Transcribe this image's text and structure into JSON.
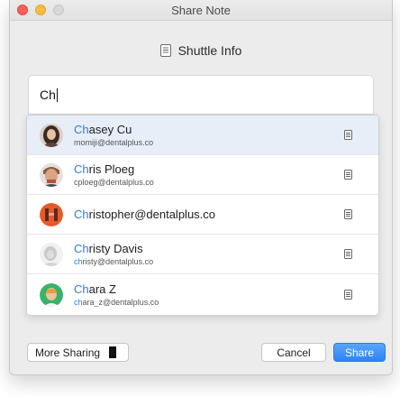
{
  "window": {
    "title": "Share Note"
  },
  "note": {
    "title": "Shuttle Info",
    "icon": "note-document-icon"
  },
  "search": {
    "prefix": "Ch",
    "value": ""
  },
  "contacts": [
    {
      "highlight": "Ch",
      "name_rest": "asey Cu",
      "email_highlight": "",
      "email_rest": "momiji@dentalplus.co",
      "selected": true,
      "avatar": "woman-photo"
    },
    {
      "highlight": "Ch",
      "name_rest": "ris Ploeg",
      "email_highlight": "",
      "email_rest": "cploeg@dentalplus.co",
      "selected": false,
      "avatar": "man-photo"
    },
    {
      "highlight": "Ch",
      "name_rest": "ristopher@dentalplus.co",
      "email_highlight": "",
      "email_rest": "",
      "selected": false,
      "avatar": "orange-avatar"
    },
    {
      "highlight": "Ch",
      "name_rest": "risty Davis",
      "email_highlight": "ch",
      "email_rest": "risty@dentalplus.co",
      "selected": false,
      "avatar": "gray-photo"
    },
    {
      "highlight": "Ch",
      "name_rest": "ara Z",
      "email_highlight": "ch",
      "email_rest": "ara_z@dentalplus.co",
      "selected": false,
      "avatar": "green-avatar"
    }
  ],
  "footer": {
    "more_sharing": "More Sharing",
    "cancel": "Cancel",
    "share": "Share"
  },
  "colors": {
    "highlight": "#2d7de0",
    "selected_row": "#e7eef8",
    "share_button": "#2d83f6"
  }
}
